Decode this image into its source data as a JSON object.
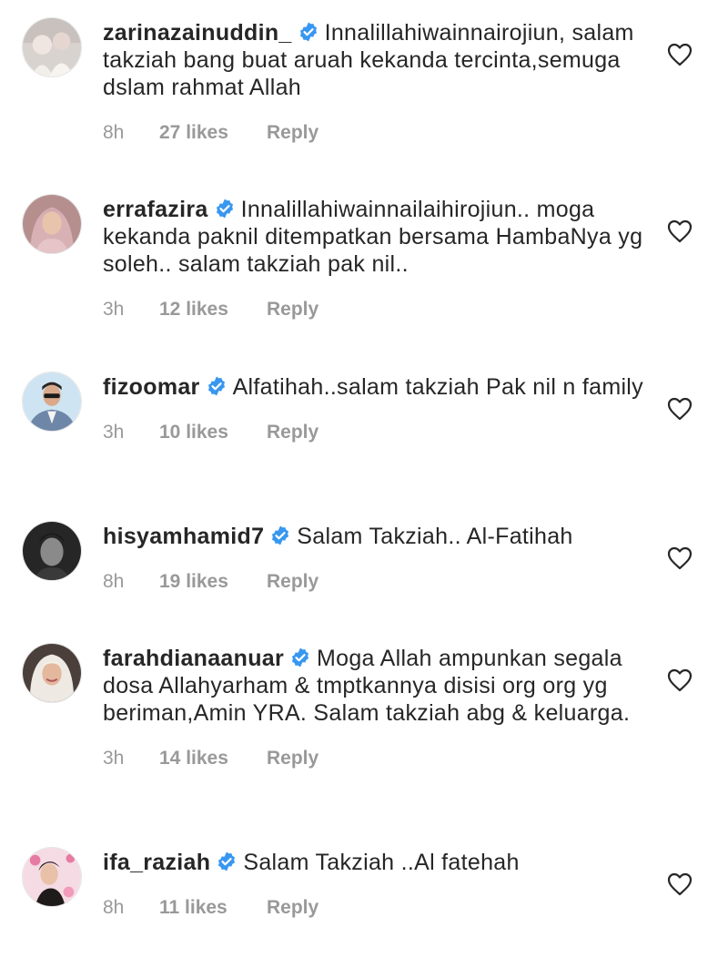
{
  "colors": {
    "verified": "#3897f0",
    "meta_text": "#999999",
    "text": "#262626"
  },
  "icons": {
    "verified": "verified-badge-icon",
    "like": "heart-outline-icon"
  },
  "comments": [
    {
      "username": "zarinazainuddin_",
      "text": "Innalillahiwainnairojiun, salam takziah bang buat aruah kekanda tercinta,semuga dslam rahmat Allah",
      "time": "8h",
      "likes": "27 likes",
      "reply": "Reply"
    },
    {
      "username": "errafazira",
      "text": "Innalillahiwainnailaihirojiun.. moga kekanda paknil ditempatkan bersama HambaNya yg soleh.. salam takziah pak nil..",
      "time": "3h",
      "likes": "12 likes",
      "reply": "Reply"
    },
    {
      "username": "fizoomar",
      "text": "Alfatihah..salam takziah Pak nil n family",
      "time": "3h",
      "likes": "10 likes",
      "reply": "Reply"
    },
    {
      "username": "hisyamhamid7",
      "text": "Salam Takziah.. Al-Fatihah",
      "time": "8h",
      "likes": "19 likes",
      "reply": "Reply"
    },
    {
      "username": "farahdianaanuar",
      "text": "Moga Allah ampunkan segala dosa Allahyarham & tmptkannya disisi org org yg beriman,Amin YRA. Salam takziah abg & keluarga.",
      "time": "3h",
      "likes": "14 likes",
      "reply": "Reply"
    },
    {
      "username": "ifa_raziah",
      "text": "Salam Takziah ..Al fatehah",
      "time": "8h",
      "likes": "11 likes",
      "reply": "Reply"
    }
  ]
}
